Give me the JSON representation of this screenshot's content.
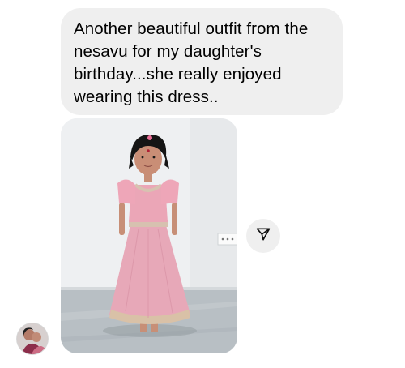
{
  "message": {
    "text": "Another beautiful outfit from the nesavu for my daughter's birthday...she really enjoyed wearing this dress.."
  },
  "attachment": {
    "type": "photo"
  },
  "share": {
    "icon": "paper-plane-icon"
  },
  "sender": {
    "avatar": "profile-photo"
  },
  "colors": {
    "bubble": "#efefef",
    "text": "#000000",
    "dress": "#e6a7b8"
  }
}
